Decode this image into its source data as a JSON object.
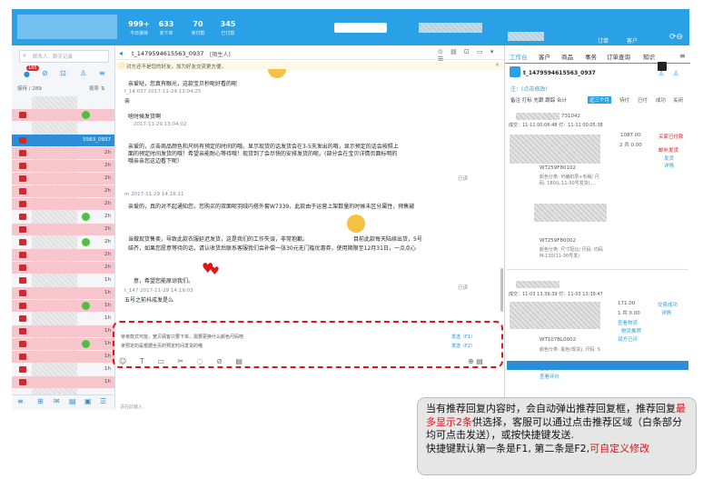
{
  "top_stats": [
    {
      "value": "999+",
      "label": "今日接待"
    },
    {
      "value": "633",
      "label": "未下单"
    },
    {
      "value": "70",
      "label": "未付款"
    },
    {
      "value": "345",
      "label": "已付款"
    }
  ],
  "left": {
    "search_placeholder": "联系人、聊天记录",
    "badge": "185",
    "list_header_left": "接待 / 289",
    "list_header_right": "按序 ⇅",
    "rows": [
      {
        "time": "",
        "style": "white"
      },
      {
        "time": "",
        "style": "pink"
      },
      {
        "time": "",
        "style": "white"
      },
      {
        "time": "5563_0937",
        "style": "blue",
        "time2": "2h"
      },
      {
        "time": "2h",
        "style": "pink"
      },
      {
        "time": "2h",
        "style": "pink"
      },
      {
        "time": "2h",
        "style": "pink"
      },
      {
        "time": "2h",
        "style": "pink"
      },
      {
        "time": "2h",
        "style": "pink"
      },
      {
        "time": "2h",
        "style": "white"
      },
      {
        "time": "2h",
        "style": "pink"
      },
      {
        "time": "2h",
        "style": "white"
      },
      {
        "time": "2h",
        "style": "pink"
      },
      {
        "time": "2h",
        "style": "pink"
      },
      {
        "time": "1h",
        "style": "white"
      },
      {
        "time": "1h",
        "style": "pink"
      },
      {
        "time": "1h",
        "style": "pink"
      },
      {
        "time": "1h",
        "style": "white"
      },
      {
        "time": "1h",
        "style": "pink"
      },
      {
        "time": "1h",
        "style": "pink"
      },
      {
        "time": "1h",
        "style": "pink"
      },
      {
        "time": "1h",
        "style": "white"
      },
      {
        "time": "1h",
        "style": "pink"
      }
    ]
  },
  "chat": {
    "title": "t_1479594615563_0937",
    "title_tag": "[陌生人]",
    "notice": "对方还不是您的好友，加为好友交流更方便。",
    "messages": [
      {
        "meta": "",
        "text": "亲爱哒，您真有眼光，这款宝贝秒呢好看的呢"
      },
      {
        "meta": "t_14 037  2017-11-29 13:04:25",
        "text": "亲"
      },
      {
        "meta": "",
        "text": "啥时候发货啊"
      },
      {
        "meta": "2017-11-29 13:04:02",
        "text": ""
      },
      {
        "meta": "",
        "text": "亲爱的，点击商品颜色和尺码有预定的时间的哦。显示现货的话发货会在3-5天发出的哦，显示预定的话会按照上"
      },
      {
        "meta": "",
        "text": "面的预定时间发货的哦！希望亲能耐心等待哦！现货到了会尽快的安排发货的呢。(部分会在宝贝详情页面标明的"
      },
      {
        "meta": "",
        "text": "哦亲亲您这边看下呢）"
      },
      {
        "meta": "m  2017-11-29 14:18:11",
        "text": ""
      },
      {
        "meta": "",
        "text": "亲爱的，真的对不起通知您，您购买的双面呢羽绒内搭外套W7339，此款由于运营上架数量的时候未区分属性，预售被"
      },
      {
        "meta": "",
        "text": "当做现货售卖，导致此款衣服延迟发货，这是我们的工作失误，非常抱歉。"
      },
      {
        "meta": "",
        "text": "目前此款每天陆续出货，5号"
      },
      {
        "meta": "",
        "text": "结齐，如果您愿意等待的话，请认收货后联系客服我们会补偿一张30元无门槛优惠券，使用期限至12月31日，一点点心"
      },
      {
        "meta": "",
        "text": "意，希望您能原谅我们。"
      },
      {
        "meta": "t_147  2017-11-29 14:19:03",
        "text": "五号之前抖成发是么"
      }
    ],
    "read": "已读",
    "suggest": [
      {
        "text": "亲亲款式可能，宽贝顾客只要下单，需要更换什么颜色尺码吧",
        "key": "发送（F1）"
      },
      {
        "text": "亲预定的是根据全页的预定时间发货的哦",
        "key": "发送（F2）"
      }
    ],
    "footer": "请在此输入"
  },
  "right": {
    "tabs": [
      "工作台",
      "客户",
      "商品",
      "事务",
      "订单查询",
      "知识"
    ],
    "top_tabs": [
      "订单",
      "客户"
    ],
    "customer_id": "t_1479594615563_0937",
    "customer_note": "注：(点击修改)",
    "note_label": "备注 打标 先跟 跟踪 合计",
    "order_tabs": [
      "近三个月",
      "待付",
      "已付",
      "成功",
      "关闭",
      "更多"
    ],
    "order1": {
      "id": "731042",
      "time": "成交：11-11 00:06:48  付：11-11 00:05:38",
      "price": "1087.00",
      "qty": "2  共 0.00",
      "act1": "买家已付款",
      "act2": "邮补发货",
      "act3": "发货",
      "act4": "详情",
      "goods": [
        {
          "code": "WT259F80102",
          "desc": "颜色分类: 可编织层+毛绳/ 尺码: 180(L 11-30号发货),..."
        },
        {
          "code": "WT259F80002",
          "desc": "颜色分类: 尺寸配比/ 尺码: 均码 M-130(11-30号发)"
        }
      ]
    },
    "order2": {
      "id": "",
      "time": "成交：11-03 13:39:39  付：11-03 13:39:47",
      "price": "171.00",
      "qty": "1  共 0.00",
      "act1": "交易成功",
      "act2": "详情",
      "goods": [
        {
          "code": "WT107BL0002",
          "desc": "颜色分类: 黑色(现货), 尺码: S"
        }
      ],
      "links": [
        "查看物流",
        "物流推荐",
        "双方已评",
        "查看物流",
        "查看评价"
      ]
    }
  },
  "callout": {
    "p1": "当有推荐回复内容时，会自动弹出推荐回复框，推荐回复",
    "p1_red": "最多显示2条",
    "p2": "供选择，客服可以通过点击推荐区域（白条部分均可点击发送），或按快捷键发送.",
    "p3": "快捷键默认第一条是F1, 第二条是F2,",
    "p3_red": "可自定义修改"
  },
  "colors": {
    "brand": "#2aa0e6",
    "pink": "#f7c6cc",
    "red": "#d9141b"
  }
}
